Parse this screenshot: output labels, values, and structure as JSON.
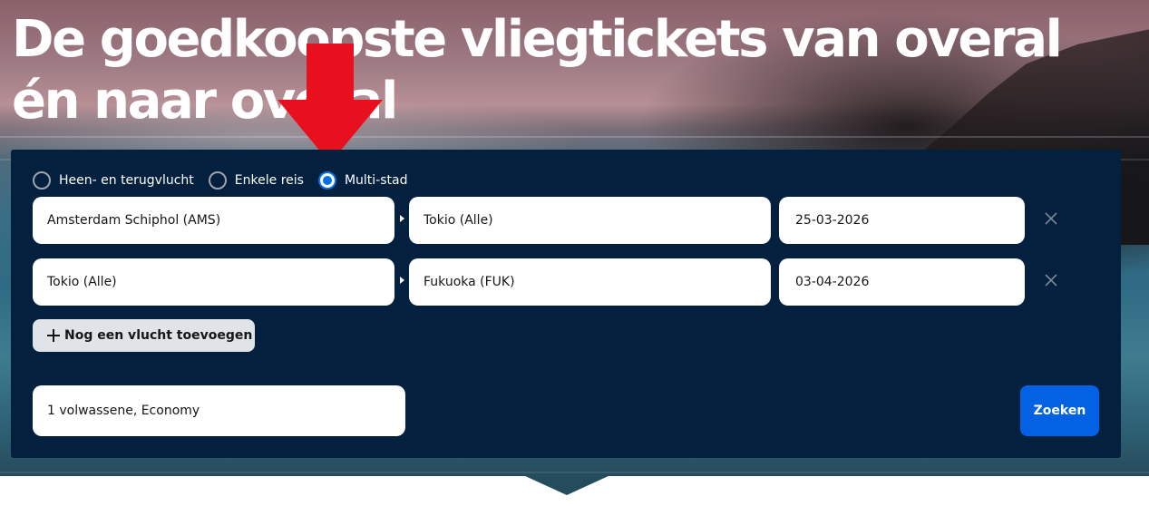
{
  "hero": {
    "headline": "De goedkoopste vliegtickets van overal én naar overal"
  },
  "trip_types": [
    {
      "label": "Heen- en terugvlucht",
      "selected": false
    },
    {
      "label": "Enkele reis",
      "selected": false
    },
    {
      "label": "Multi-stad",
      "selected": true
    }
  ],
  "legs": [
    {
      "from": "Amsterdam Schiphol (AMS)",
      "to": "Tokio (Alle)",
      "date": "25-03-2026"
    },
    {
      "from": "Tokio (Alle)",
      "to": "Fukuoka (FUK)",
      "date": "03-04-2026"
    }
  ],
  "add_flight_label": "Nog een vlucht toevoegen",
  "travellers": "1 volwassene, Economy",
  "search_label": "Zoeken",
  "colors": {
    "panel": "#03213f",
    "accent": "#0770e3",
    "search_button": "#0362e3",
    "annotation_arrow": "#e8101e"
  },
  "icons": [
    "radio-icon",
    "arrow-right-icon",
    "close-icon",
    "plus-icon",
    "red-down-arrow-icon"
  ]
}
